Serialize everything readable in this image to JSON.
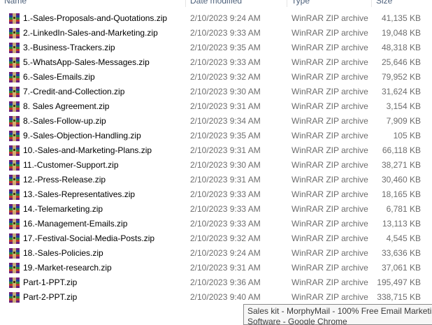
{
  "columns": {
    "name": "Name",
    "date": "Date modified",
    "type": "Type",
    "size": "Size"
  },
  "files": [
    {
      "name": "1.-Sales-Proposals-and-Quotations.zip",
      "date": "2/10/2023 9:24 AM",
      "type": "WinRAR ZIP archive",
      "size": "41,135 KB"
    },
    {
      "name": "2.-LinkedIn-Sales-and-Marketing.zip",
      "date": "2/10/2023 9:33 AM",
      "type": "WinRAR ZIP archive",
      "size": "19,048 KB"
    },
    {
      "name": "3.-Business-Trackers.zip",
      "date": "2/10/2023 9:35 AM",
      "type": "WinRAR ZIP archive",
      "size": "48,318 KB"
    },
    {
      "name": "5.-WhatsApp-Sales-Messages.zip",
      "date": "2/10/2023 9:33 AM",
      "type": "WinRAR ZIP archive",
      "size": "25,646 KB"
    },
    {
      "name": "6.-Sales-Emails.zip",
      "date": "2/10/2023 9:32 AM",
      "type": "WinRAR ZIP archive",
      "size": "79,952 KB"
    },
    {
      "name": "7.-Credit-and-Collection.zip",
      "date": "2/10/2023 9:30 AM",
      "type": "WinRAR ZIP archive",
      "size": "31,624 KB"
    },
    {
      "name": "8. Sales Agreement.zip",
      "date": "2/10/2023 9:31 AM",
      "type": "WinRAR ZIP archive",
      "size": "3,154 KB"
    },
    {
      "name": "8.-Sales-Follow-up.zip",
      "date": "2/10/2023 9:34 AM",
      "type": "WinRAR ZIP archive",
      "size": "7,909 KB"
    },
    {
      "name": "9.-Sales-Objection-Handling.zip",
      "date": "2/10/2023 9:35 AM",
      "type": "WinRAR ZIP archive",
      "size": "105 KB"
    },
    {
      "name": "10.-Sales-and-Marketing-Plans.zip",
      "date": "2/10/2023 9:31 AM",
      "type": "WinRAR ZIP archive",
      "size": "66,118 KB"
    },
    {
      "name": "11.-Customer-Support.zip",
      "date": "2/10/2023 9:30 AM",
      "type": "WinRAR ZIP archive",
      "size": "38,271 KB"
    },
    {
      "name": "12.-Press-Release.zip",
      "date": "2/10/2023 9:31 AM",
      "type": "WinRAR ZIP archive",
      "size": "30,460 KB"
    },
    {
      "name": "13.-Sales-Representatives.zip",
      "date": "2/10/2023 9:33 AM",
      "type": "WinRAR ZIP archive",
      "size": "18,165 KB"
    },
    {
      "name": "14.-Telemarketing.zip",
      "date": "2/10/2023 9:33 AM",
      "type": "WinRAR ZIP archive",
      "size": "6,781 KB"
    },
    {
      "name": "16.-Management-Emails.zip",
      "date": "2/10/2023 9:33 AM",
      "type": "WinRAR ZIP archive",
      "size": "13,113 KB"
    },
    {
      "name": "17.-Festival-Social-Media-Posts.zip",
      "date": "2/10/2023 9:32 AM",
      "type": "WinRAR ZIP archive",
      "size": "4,545 KB"
    },
    {
      "name": "18.-Sales-Policies.zip",
      "date": "2/10/2023 9:24 AM",
      "type": "WinRAR ZIP archive",
      "size": "33,636 KB"
    },
    {
      "name": "19.-Market-research.zip",
      "date": "2/10/2023 9:31 AM",
      "type": "WinRAR ZIP archive",
      "size": "37,061 KB"
    },
    {
      "name": "Part-1-PPT.zip",
      "date": "2/10/2023 9:36 AM",
      "type": "WinRAR ZIP archive",
      "size": "195,497 KB"
    },
    {
      "name": "Part-2-PPT.zip",
      "date": "2/10/2023 9:40 AM",
      "type": "WinRAR ZIP archive",
      "size": "338,715 KB"
    }
  ],
  "file_icon": "winrar-archive-icon",
  "tooltip": {
    "line1": "Sales kit - MorphyMail - 100% Free Email Marketin",
    "line2": "Software - Google Chrome"
  }
}
